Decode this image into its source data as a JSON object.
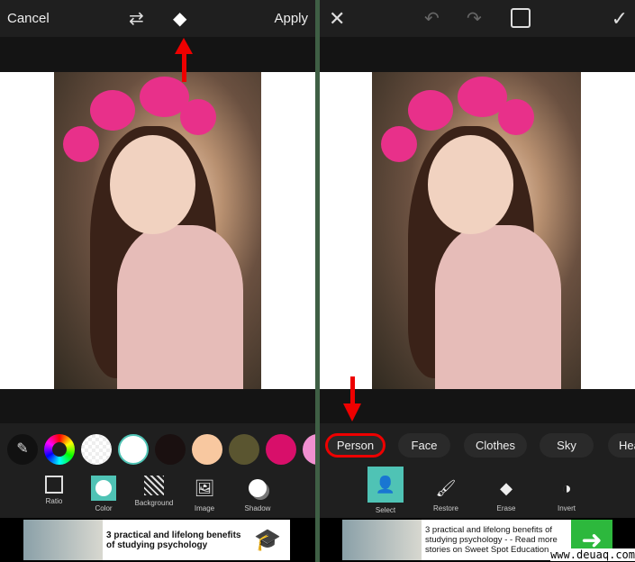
{
  "left": {
    "topbar": {
      "cancel": "Cancel",
      "apply": "Apply",
      "icons": [
        "swap-icon",
        "eraser-icon"
      ]
    },
    "swatches": [
      "#1a1a1a",
      "rainbow",
      "transparent",
      "#ffffff",
      "#1a1010",
      "#f8c8a0",
      "#5a5530",
      "#d80f6a",
      "#f090d0"
    ],
    "tools": [
      {
        "label": "Ratio",
        "icon": "ratio-icon"
      },
      {
        "label": "Color",
        "icon": "color-icon",
        "active": true
      },
      {
        "label": "Background",
        "icon": "background-icon"
      },
      {
        "label": "Image",
        "icon": "image-icon"
      },
      {
        "label": "Shadow",
        "icon": "shadow-icon"
      }
    ],
    "ad": {
      "text": "3 practical and lifelong benefits of studying psychology"
    }
  },
  "right": {
    "topbar": {
      "icons": [
        "close-icon",
        "undo-icon",
        "redo-icon",
        "compare-icon",
        "check-icon"
      ]
    },
    "chips": [
      "Person",
      "Face",
      "Clothes",
      "Sky",
      "Hea"
    ],
    "tools": [
      {
        "label": "Select",
        "icon": "select-person-icon",
        "active": true
      },
      {
        "label": "Restore",
        "icon": "brush-icon"
      },
      {
        "label": "Erase",
        "icon": "eraser-icon"
      },
      {
        "label": "Invert",
        "icon": "invert-icon"
      }
    ],
    "ad": {
      "text": "3 practical and lifelong benefits of studying psychology - - Read more stories on Sweet Spot Education"
    }
  },
  "watermark": "www.deuaq.com",
  "colors": {
    "accent": "#4fc3b5",
    "annotation": "#e00000"
  }
}
